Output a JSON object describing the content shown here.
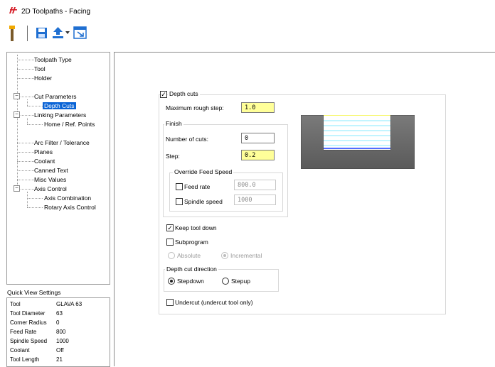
{
  "window": {
    "title": "2D Toolpaths - Facing"
  },
  "toolbar": {
    "icons": [
      "tool-icon",
      "save-icon",
      "upload-icon",
      "dropdown-icon",
      "screen-select-icon"
    ]
  },
  "tree": {
    "items": [
      "Toolpath Type",
      "Tool",
      "Holder",
      "Cut Parameters",
      "Depth Cuts",
      "Linking Parameters",
      "Home / Ref. Points",
      "Arc Filter / Tolerance",
      "Planes",
      "Coolant",
      "Canned Text",
      "Misc Values",
      "Axis Control",
      "Axis Combination",
      "Rotary Axis Control"
    ],
    "selected": "Depth Cuts"
  },
  "quick_view": {
    "title": "Quick View Settings",
    "rows": [
      {
        "key": "Tool",
        "value": "GLAVA 63"
      },
      {
        "key": "Tool Diameter",
        "value": "63"
      },
      {
        "key": "Corner Radius",
        "value": "0"
      },
      {
        "key": "Feed Rate",
        "value": "800"
      },
      {
        "key": "Spindle Speed",
        "value": "1000"
      },
      {
        "key": "Coolant",
        "value": "Off"
      },
      {
        "key": "Tool Length",
        "value": "21"
      }
    ]
  },
  "depth_cuts": {
    "label": "Depth cuts",
    "checked": true,
    "max_rough_step_label": "Maximum rough step:",
    "max_rough_step": "1.0",
    "finish": {
      "label": "Finish",
      "num_cuts_label": "Number of cuts:",
      "num_cuts": "0",
      "step_label": "Step:",
      "step": "0.2",
      "override": {
        "label": "Override Feed Speed",
        "feed_rate_label": "Feed rate",
        "feed_rate": "800.0",
        "spindle_speed_label": "Spindle speed",
        "spindle_speed": "1000"
      }
    },
    "keep_tool_down_label": "Keep tool down",
    "keep_tool_down": true,
    "subprogram_label": "Subprogram",
    "subprogram": false,
    "absolute_label": "Absolute",
    "incremental_label": "Incremental",
    "direction": {
      "label": "Depth cut direction",
      "stepdown_label": "Stepdown",
      "stepup_label": "Stepup",
      "selected": "Stepdown"
    },
    "undercut_label": "Undercut (undercut tool only)",
    "undercut": false
  },
  "colors": {
    "selection": "#0a64d6",
    "highlight_input": "#ffff99",
    "preview_dark": "#6e6e6e",
    "preview_cut": "#5ee0ff"
  }
}
